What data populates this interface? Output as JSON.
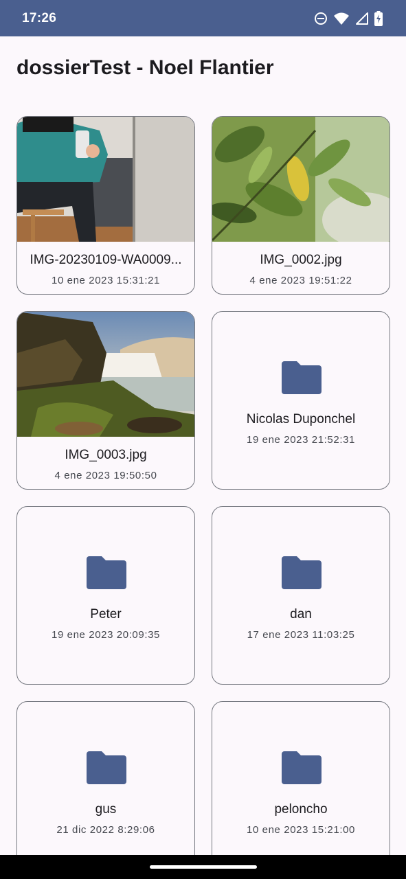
{
  "status_bar": {
    "time": "17:26",
    "icons": [
      "do-not-disturb-icon",
      "wifi-icon",
      "cellular-signal-icon",
      "battery-charging-icon"
    ]
  },
  "header": {
    "title": "dossierTest - Noel Flantier"
  },
  "theme": {
    "accent": "#4a5f8f",
    "folder": "#4a5f8f",
    "border": "#74777f",
    "background": "#fcf8fc"
  },
  "items": [
    {
      "type": "image",
      "name": "IMG-20230109-WA0009...",
      "date": "10 ene 2023 15:31:21",
      "thumbnail": "person-mirror-selfie"
    },
    {
      "type": "image",
      "name": "IMG_0002.jpg",
      "date": "4 ene 2023 19:51:22",
      "thumbnail": "green-leaves"
    },
    {
      "type": "image",
      "name": "IMG_0003.jpg",
      "date": "4 ene 2023 19:50:50",
      "thumbnail": "waterfall-landscape"
    },
    {
      "type": "folder",
      "name": "Nicolas Duponchel",
      "date": "19 ene 2023 21:52:31",
      "icon": "folder-icon"
    },
    {
      "type": "folder",
      "name": "Peter",
      "date": "19 ene 2023 20:09:35",
      "icon": "folder-icon"
    },
    {
      "type": "folder",
      "name": "dan",
      "date": "17 ene 2023 11:03:25",
      "icon": "folder-icon"
    },
    {
      "type": "folder",
      "name": "gus",
      "date": "21 dic 2022 8:29:06",
      "icon": "folder-icon"
    },
    {
      "type": "folder",
      "name": "peloncho",
      "date": "10 ene 2023 15:21:00",
      "icon": "folder-icon"
    }
  ]
}
